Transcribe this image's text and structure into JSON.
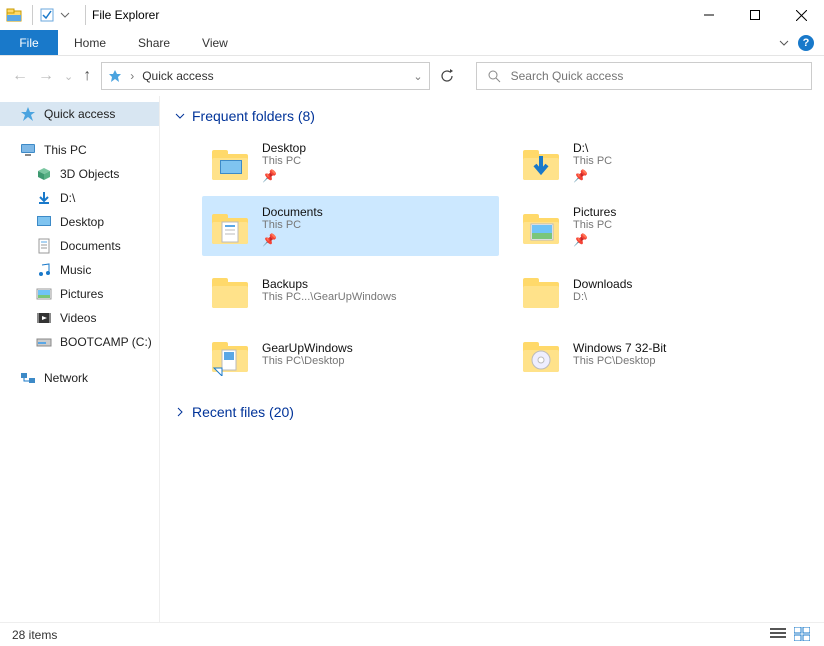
{
  "title": "File Explorer",
  "menu": {
    "file": "File",
    "home": "Home",
    "share": "Share",
    "view": "View"
  },
  "address": {
    "location": "Quick access"
  },
  "search": {
    "placeholder": "Search Quick access"
  },
  "sidebar": {
    "quick_access": "Quick access",
    "this_pc": "This PC",
    "items": [
      {
        "label": "3D Objects"
      },
      {
        "label": "D:\\"
      },
      {
        "label": "Desktop"
      },
      {
        "label": "Documents"
      },
      {
        "label": "Music"
      },
      {
        "label": "Pictures"
      },
      {
        "label": "Videos"
      },
      {
        "label": "BOOTCAMP (C:)"
      }
    ],
    "network": "Network"
  },
  "sections": {
    "frequent": "Frequent folders (8)",
    "recent": "Recent files (20)"
  },
  "folders": [
    {
      "name": "Desktop",
      "loc": "This PC",
      "icon": "desktop",
      "pinned": true
    },
    {
      "name": "D:\\",
      "loc": "This PC",
      "icon": "download",
      "pinned": true
    },
    {
      "name": "Documents",
      "loc": "This PC",
      "icon": "documents",
      "pinned": true,
      "selected": true
    },
    {
      "name": "Pictures",
      "loc": "This PC",
      "icon": "pictures",
      "pinned": true
    },
    {
      "name": "Backups",
      "loc": "This PC...\\GearUpWindows",
      "icon": "folder",
      "pinned": false
    },
    {
      "name": "Downloads",
      "loc": "D:\\",
      "icon": "folder",
      "pinned": false
    },
    {
      "name": "GearUpWindows",
      "loc": "This PC\\Desktop",
      "icon": "shortcut",
      "pinned": false
    },
    {
      "name": "Windows 7 32-Bit",
      "loc": "This PC\\Desktop",
      "icon": "iso",
      "pinned": false
    }
  ],
  "status": {
    "count": "28 items"
  }
}
